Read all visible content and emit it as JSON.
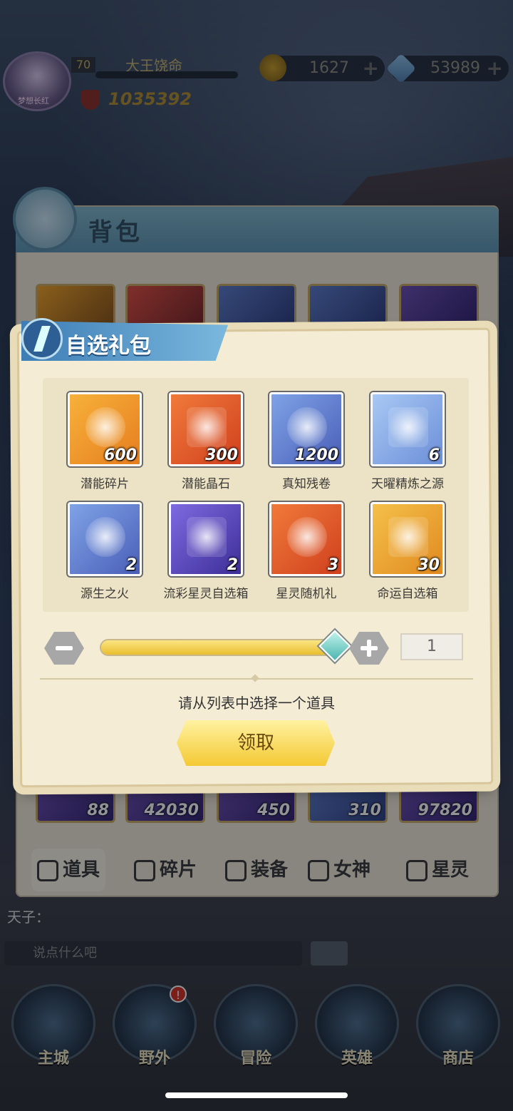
{
  "header": {
    "level": "70",
    "player_name": "大王饶命",
    "avatar_label": "梦想长红",
    "power": "1035392",
    "gold": "1627",
    "diamonds": "53989"
  },
  "bag": {
    "title": "背包",
    "row_counts": [
      "88",
      "42030",
      "450",
      "310",
      "97820"
    ],
    "tabs": [
      "道具",
      "碎片",
      "装备",
      "女神",
      "星灵"
    ]
  },
  "modal": {
    "title": "自选礼包",
    "items": [
      {
        "name": "潜能碎片",
        "count": "600",
        "bg": "#f7b13a",
        "icon": "shard-icon"
      },
      {
        "name": "潜能晶石",
        "count": "300",
        "bg": "#f07a3a",
        "icon": "crystal-star-icon"
      },
      {
        "name": "真知残卷",
        "count": "1200",
        "bg": "#7fa2e6",
        "icon": "scroll-icon"
      },
      {
        "name": "天曜精炼之源",
        "count": "6",
        "bg": "#a8c8f4",
        "icon": "tower-icon"
      },
      {
        "name": "源生之火",
        "count": "2",
        "bg": "#7fa2e6",
        "icon": "flame-orb-icon"
      },
      {
        "name": "流彩星灵自选箱",
        "count": "2",
        "bg": "#7e6ae0",
        "icon": "chest-icon"
      },
      {
        "name": "星灵随机礼",
        "count": "3",
        "bg": "#f07a3a",
        "icon": "mystery-chest-icon"
      },
      {
        "name": "命运自选箱",
        "count": "30",
        "bg": "#f5c04a",
        "icon": "gold-chest-icon"
      }
    ],
    "quantity": "1",
    "slider_fraction": 1.0,
    "hint": "请从列表中选择一个道具",
    "claim_label": "领取"
  },
  "chat": {
    "line": "天子：",
    "placeholder": "说点什么吧"
  },
  "nav": {
    "items": [
      "主城",
      "野外",
      "冒险",
      "英雄",
      "商店"
    ],
    "field_badge": "!"
  }
}
